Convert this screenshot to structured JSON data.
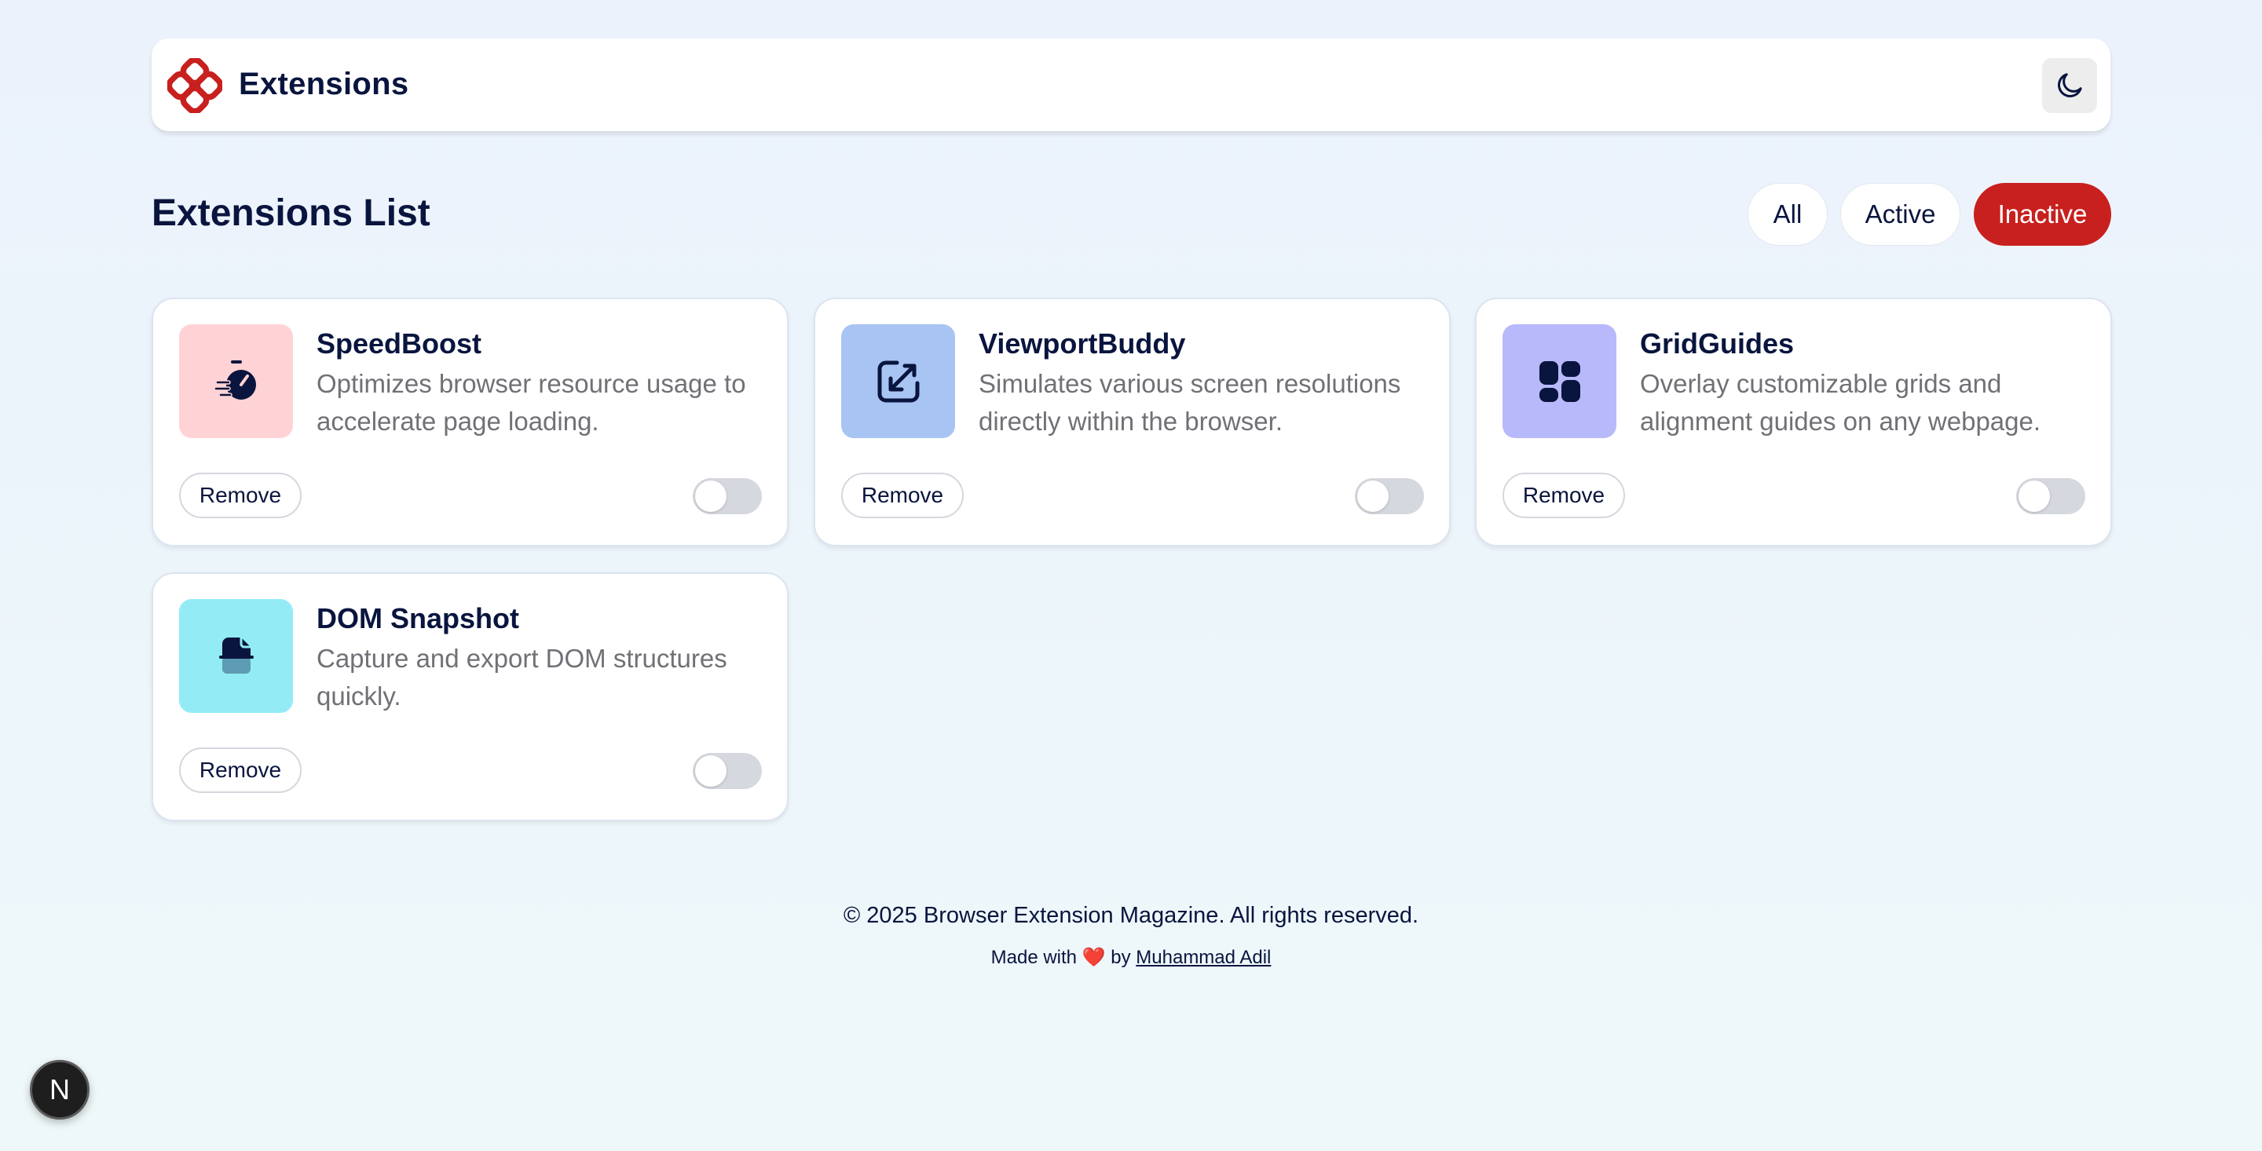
{
  "header": {
    "brand_name": "Extensions",
    "logo_icon": "flower-knot-icon",
    "theme_toggle_icon": "moon-icon"
  },
  "main": {
    "title": "Extensions List",
    "filters": [
      {
        "label": "All",
        "selected": false
      },
      {
        "label": "Active",
        "selected": false
      },
      {
        "label": "Inactive",
        "selected": true
      }
    ],
    "cards": [
      {
        "name": "SpeedBoost",
        "description": "Optimizes browser resource usage to accelerate page loading.",
        "icon": "stopwatch-icon",
        "icon_bg": "#ffd3d6",
        "remove_label": "Remove",
        "enabled": false
      },
      {
        "name": "ViewportBuddy",
        "description": "Simulates various screen resolutions directly within the browser.",
        "icon": "resize-arrow-icon",
        "icon_bg": "#a8c4f3",
        "remove_label": "Remove",
        "enabled": false
      },
      {
        "name": "GridGuides",
        "description": "Overlay customizable grids and alignment guides on any webpage.",
        "icon": "grid-layout-icon",
        "icon_bg": "#b8b9fa",
        "remove_label": "Remove",
        "enabled": false
      },
      {
        "name": "DOM Snapshot",
        "description": "Capture and export DOM structures quickly.",
        "icon": "document-stack-icon",
        "icon_bg": "#93ecf5",
        "remove_label": "Remove",
        "enabled": false
      }
    ]
  },
  "footer": {
    "copyright": "© 2025 Browser Extension Magazine. All rights reserved.",
    "made_with_prefix": "Made with",
    "heart": "❤️",
    "by_text": "by",
    "author": "Muhammad Adil"
  },
  "dev_badge": {
    "letter": "N"
  },
  "colors": {
    "accent": "#c8201e",
    "text_dark": "#09153e",
    "text_muted": "#707176"
  }
}
